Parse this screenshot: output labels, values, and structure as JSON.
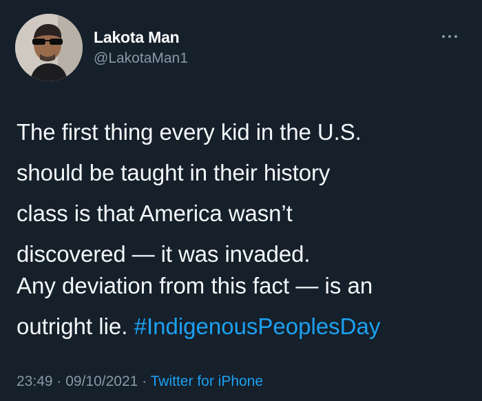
{
  "user": {
    "display_name": "Lakota Man",
    "handle": "@LakotaMan1"
  },
  "tweet": {
    "paragraph_1": "The first thing every kid in the U.S.\nshould be taught in their history\nclass is that America wasn’t\ndiscovered — it was invaded.",
    "paragraph_2_text": "Any deviation from this fact — is an\noutright lie. ",
    "hashtag": "#IndigenousPeoplesDay"
  },
  "meta": {
    "time": "23:49",
    "separator_1": " · ",
    "date": "09/10/2021",
    "separator_2": " · ",
    "source": "Twitter for iPhone"
  },
  "icons": {
    "more": "more-horizontal-icon",
    "avatar": "avatar"
  },
  "colors": {
    "background": "#15202b",
    "text": "#f5f8fa",
    "secondary": "#8899a6",
    "link": "#1da1f2"
  }
}
